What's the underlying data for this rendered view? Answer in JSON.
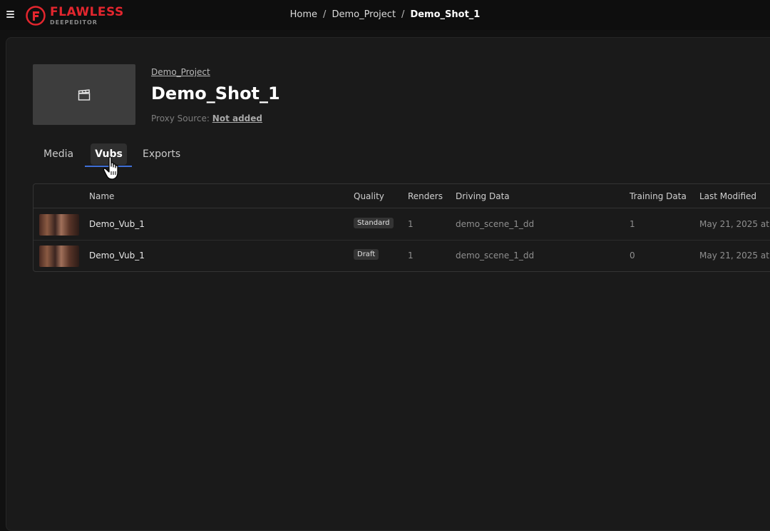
{
  "header": {
    "logo_main": "FLAWLESS",
    "logo_sub": "DEEPEDITOR",
    "breadcrumb": [
      "Home",
      "Demo_Project",
      "Demo_Shot_1"
    ],
    "brand_color": "#e3262e"
  },
  "shot": {
    "project_link": "Demo_Project",
    "title": "Demo_Shot_1",
    "proxy_label": "Proxy Source:",
    "proxy_value": "Not added",
    "thumbnail_icon": "clapperboard-icon"
  },
  "tabs": [
    {
      "label": "Media",
      "active": false
    },
    {
      "label": "Vubs",
      "active": true
    },
    {
      "label": "Exports",
      "active": false
    }
  ],
  "table": {
    "columns": [
      "Name",
      "Quality",
      "Renders",
      "Driving Data",
      "Training Data",
      "Last Modified"
    ],
    "rows": [
      {
        "name": "Demo_Vub_1",
        "quality": "Standard",
        "renders": "1",
        "driving_data": "demo_scene_1_dd",
        "training_data": "1",
        "last_modified": "May 21, 2025 at"
      },
      {
        "name": "Demo_Vub_1",
        "quality": "Draft",
        "renders": "1",
        "driving_data": "demo_scene_1_dd",
        "training_data": "0",
        "last_modified": "May 21, 2025 at"
      }
    ]
  },
  "accent_color": "#3f6fd6"
}
